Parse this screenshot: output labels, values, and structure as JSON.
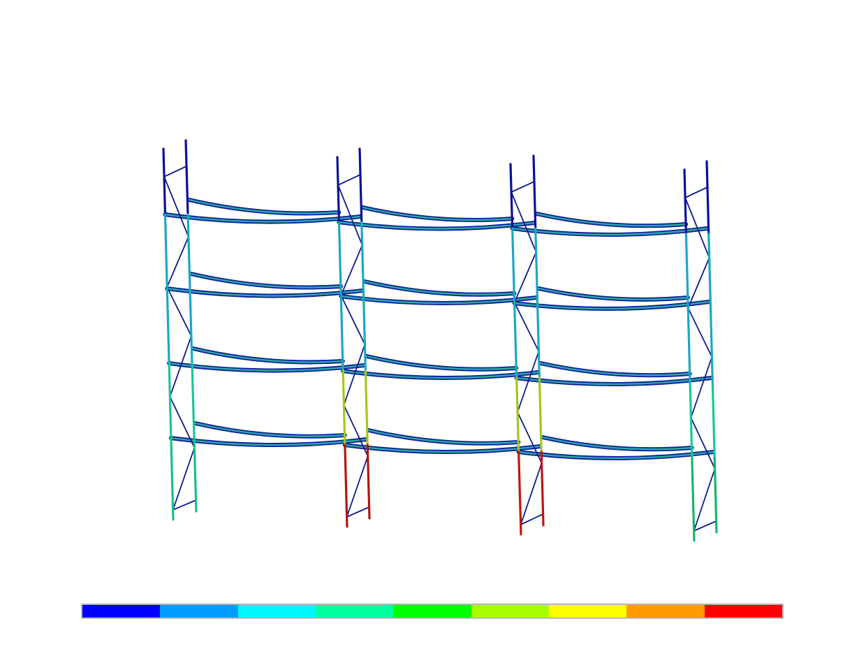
{
  "scene": {
    "type": "scaffold-fea-result",
    "bays": 3,
    "levels": 4,
    "frames": [
      {
        "id": "frame-1",
        "lower_level_color": "#18c27a"
      },
      {
        "id": "frame-2",
        "lower_level_color": "#b0160f"
      },
      {
        "id": "frame-3",
        "lower_level_color": "#c0140c"
      },
      {
        "id": "frame-4",
        "lower_level_color": "#16b46c"
      }
    ]
  },
  "colors": {
    "member_low": "#0a0f96",
    "post_upper": "#1aa7c6",
    "post_mid": "#19c59a",
    "post_mid_high": "#a3c81b",
    "ledger_inner": "#2ca9a3",
    "ledger_edge": "#0e1f9a",
    "brace": "#0c1a8c"
  },
  "legend": {
    "colors": [
      "#0000ff",
      "#009cff",
      "#00f6ff",
      "#00ffa0",
      "#00ff00",
      "#a8ff00",
      "#ffff00",
      "#ff9a00",
      "#ff0000"
    ]
  }
}
